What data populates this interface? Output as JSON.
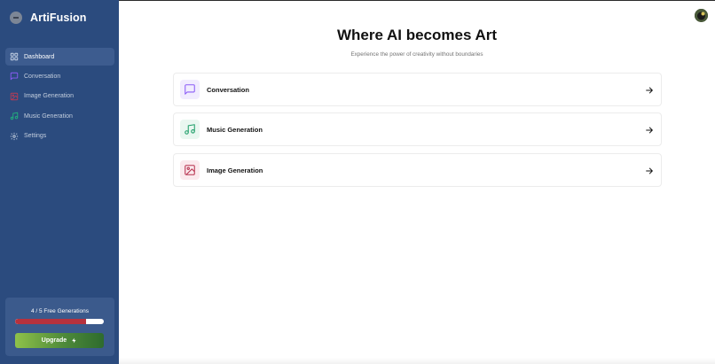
{
  "app": {
    "name": "ArtiFusion"
  },
  "sidebar": {
    "items": [
      {
        "label": "Dashboard",
        "icon": "dashboard-grid-icon",
        "color": "#c8d4e6",
        "active": true
      },
      {
        "label": "Conversation",
        "icon": "message-square-icon",
        "color": "#8b5cf6",
        "active": false
      },
      {
        "label": "Image Generation",
        "icon": "image-icon",
        "color": "#b43c56",
        "active": false
      },
      {
        "label": "Music Generation",
        "icon": "music-note-icon",
        "color": "#22b07d",
        "active": false
      },
      {
        "label": "Settings",
        "icon": "gear-icon",
        "color": "#c3cede",
        "active": false
      }
    ]
  },
  "usage": {
    "text": "4 / 5 Free Generations",
    "used": 4,
    "limit": 5,
    "upgrade_label": "Upgrade",
    "upgrade_icon": "lightning-bolt-icon"
  },
  "main": {
    "title": "Where AI becomes Art",
    "subtitle": "Experience the power of creativity without boundaries",
    "cards": [
      {
        "label": "Conversation",
        "icon": "message-square-icon",
        "color": "#8b5cf6",
        "bg": "#f1ecfe"
      },
      {
        "label": "Music Generation",
        "icon": "music-note-icon",
        "color": "#22a06b",
        "bg": "#e9f7f0"
      },
      {
        "label": "Image Generation",
        "icon": "image-icon",
        "color": "#b8324f",
        "bg": "#fbe9ed"
      }
    ]
  },
  "colors": {
    "sidebar_bg": "#2b4b7e",
    "progress": "#b6323e",
    "upgrade_gradient_start": "#8fc24a",
    "upgrade_gradient_end": "#2e6b2d"
  }
}
